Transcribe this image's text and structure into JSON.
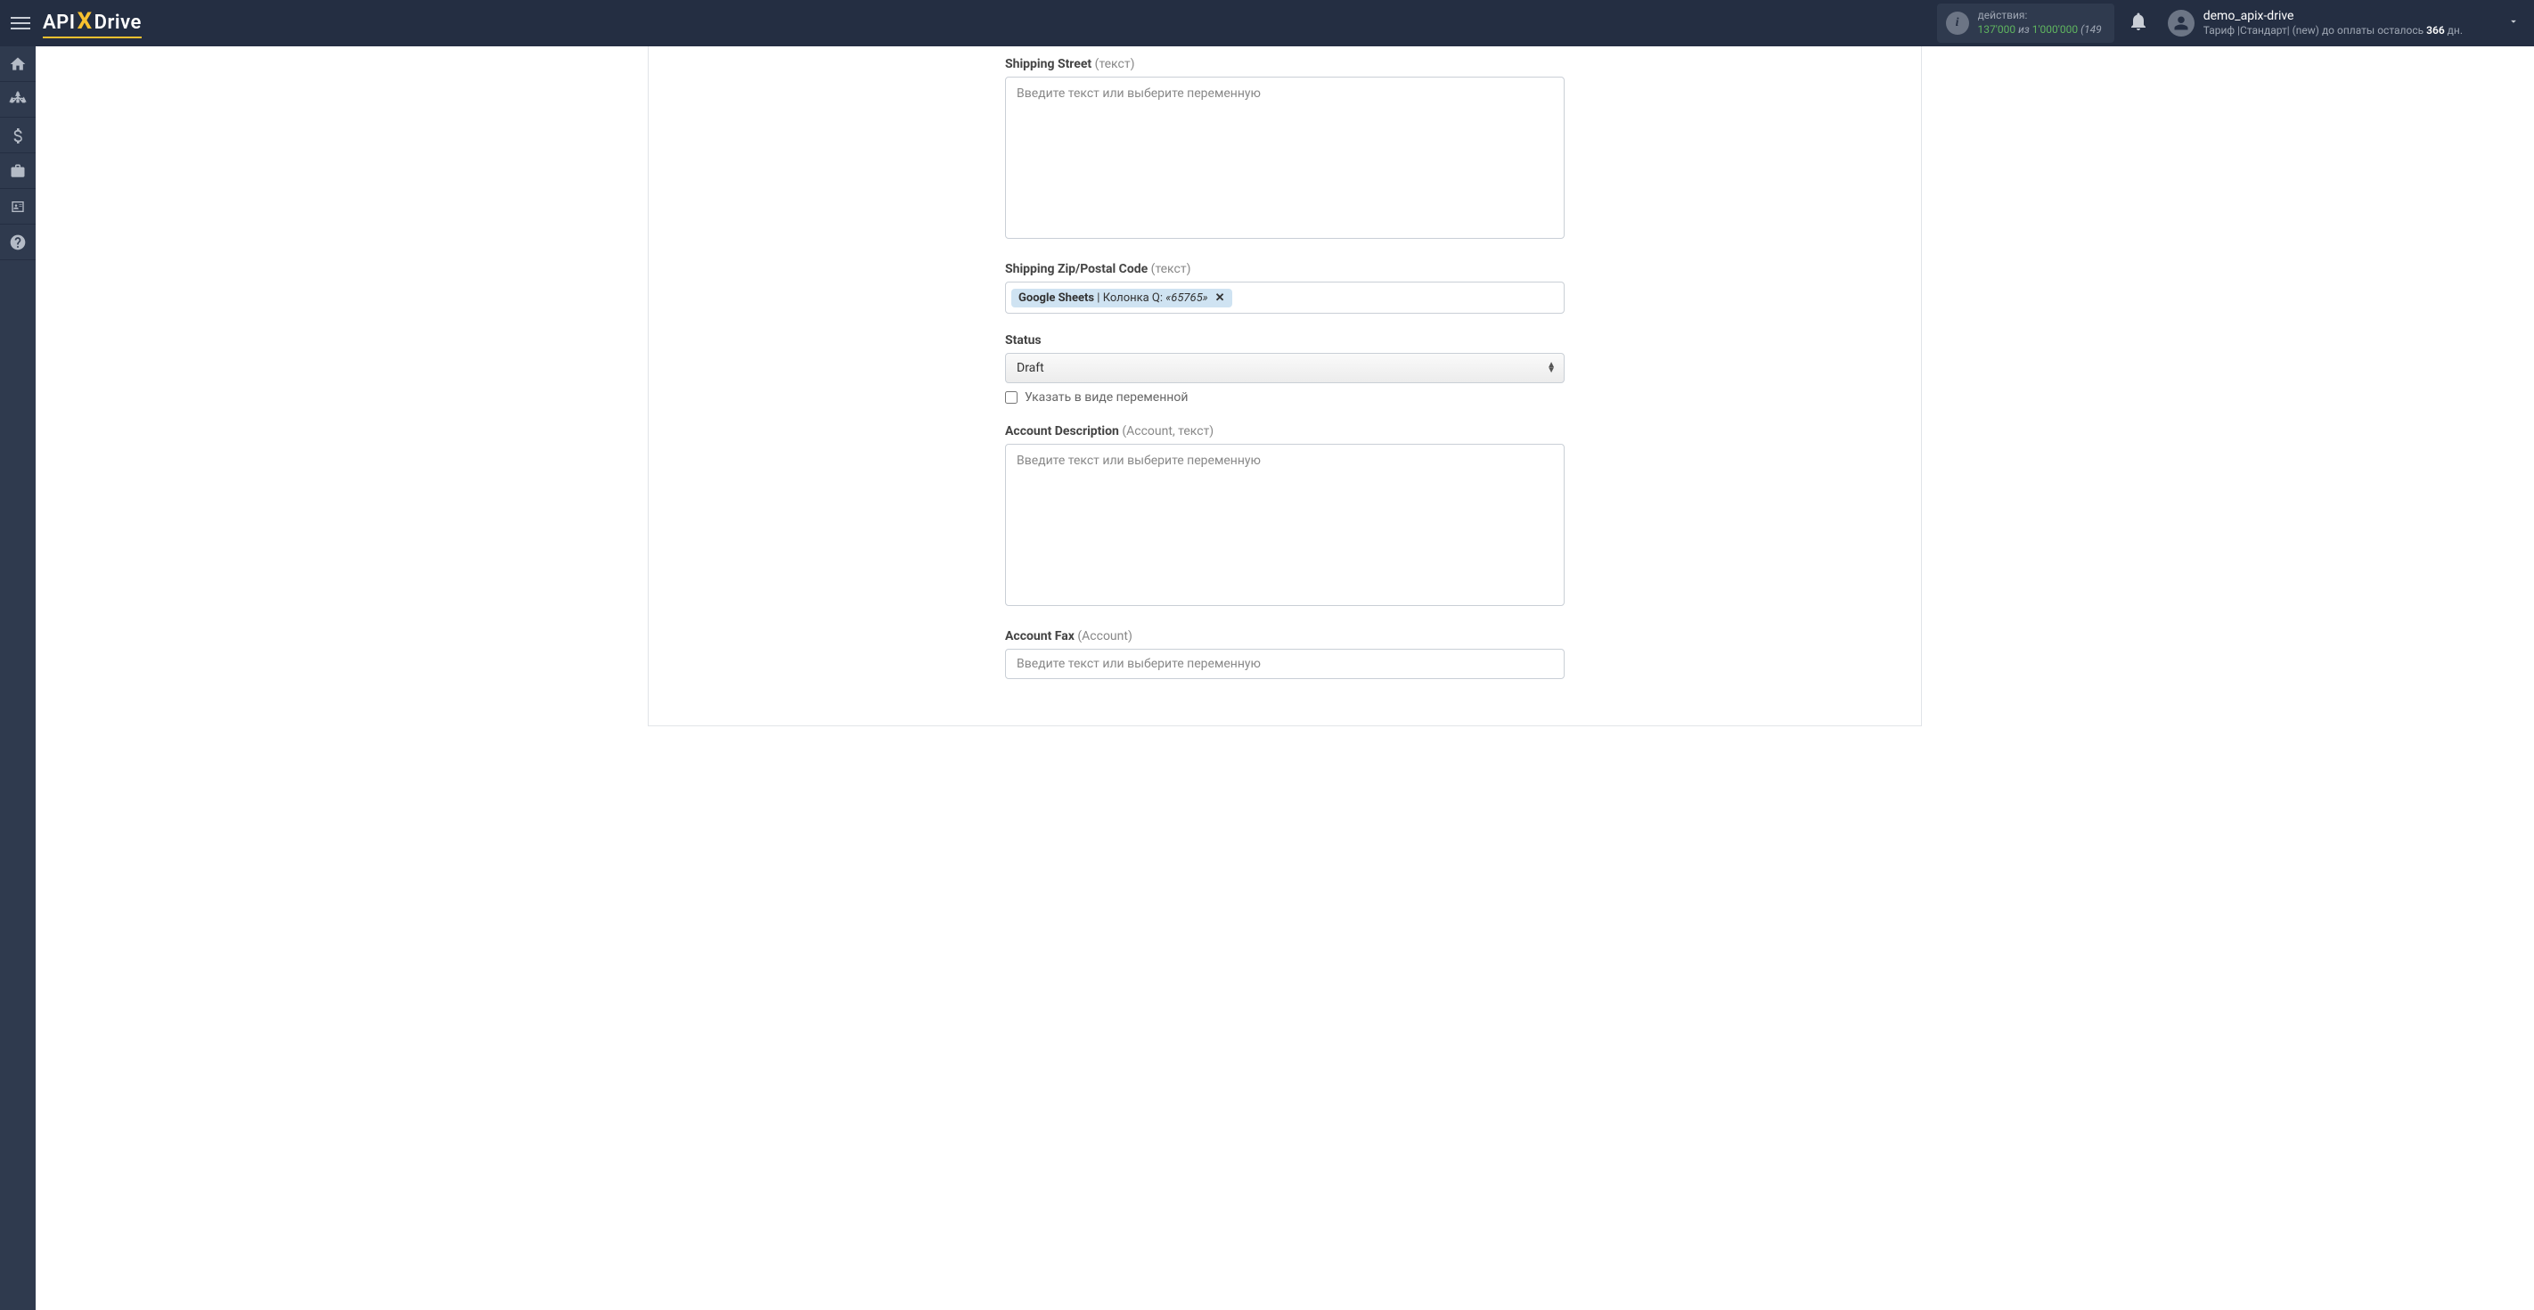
{
  "header": {
    "logo": {
      "api": "API",
      "x": "X",
      "drive": "Drive"
    },
    "actions": {
      "label": "действия:",
      "used": "137'000",
      "of": "из",
      "total": "1'000'000",
      "pct": "(149"
    },
    "user": {
      "name": "demo_apix-drive",
      "tariff_prefix": "Тариф |Стандарт| (new) до оплаты осталось ",
      "days": "366",
      "days_suffix": " дн."
    }
  },
  "form": {
    "placeholder_text": "Введите текст или выберите переменную",
    "shipping_street": {
      "label": "Shipping Street",
      "type_hint": "(текст)"
    },
    "shipping_zip": {
      "label": "Shipping Zip/Postal Code",
      "type_hint": "(текст)",
      "chip": {
        "source": "Google Sheets",
        "separator": " | ",
        "column": "Колонка Q:",
        "value": "«65765»"
      }
    },
    "status": {
      "label": "Status",
      "value": "Draft",
      "checkbox_label": "Указать в виде переменной"
    },
    "account_description": {
      "label": "Account Description",
      "type_hint": "(Account, текст)"
    },
    "account_fax": {
      "label": "Account Fax",
      "type_hint": "(Account)"
    }
  }
}
